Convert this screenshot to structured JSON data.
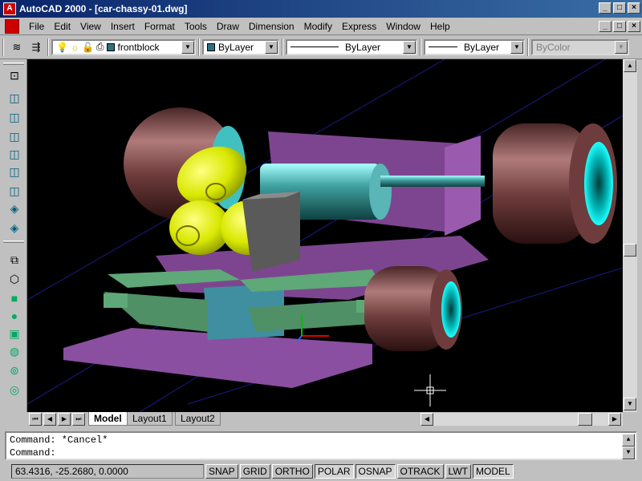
{
  "window": {
    "title": "AutoCAD 2000 - [car-chassy-01.dwg]",
    "buttons": [
      "_",
      "□",
      "×"
    ]
  },
  "menubar": {
    "items": [
      "File",
      "Edit",
      "View",
      "Insert",
      "Format",
      "Tools",
      "Draw",
      "Dimension",
      "Modify",
      "Express",
      "Window",
      "Help"
    ],
    "doc_buttons": [
      "_",
      "□",
      "×"
    ]
  },
  "properties_toolbar": {
    "layer": "frontblock",
    "color": "ByLayer",
    "linetype": "ByLayer",
    "lineweight": "ByLayer",
    "plotstyle": "ByColor",
    "accent_colors": {
      "layer_swatch": "#2f6f7f",
      "color_swatch": "#2f6f7f"
    }
  },
  "left_toolbar": {
    "icons": [
      "zoom-extents-icon",
      "box-icon",
      "wedge-icon",
      "cone-icon",
      "sphere-icon",
      "cylinder-icon",
      "torus-icon",
      "solid-icon",
      "view-icon",
      "cube-icon",
      "green-box-icon",
      "green-sphere-icon",
      "green-cube-icon",
      "globe-icon",
      "orbit-icon",
      "camera-icon"
    ]
  },
  "layout_tabs": {
    "nav_buttons": [
      "⏮",
      "◀",
      "▶",
      "⏭"
    ],
    "tabs": [
      "Model",
      "Layout1",
      "Layout2"
    ],
    "active": "Model"
  },
  "command_window": {
    "lines": [
      "Command: *Cancel*",
      "Command:"
    ]
  },
  "statusbar": {
    "coordinates": "63.4316, -25.2680, 0.0000",
    "toggles": [
      {
        "label": "SNAP",
        "on": false
      },
      {
        "label": "GRID",
        "on": false
      },
      {
        "label": "ORTHO",
        "on": false
      },
      {
        "label": "POLAR",
        "on": true
      },
      {
        "label": "OSNAP",
        "on": true
      },
      {
        "label": "OTRACK",
        "on": false
      },
      {
        "label": "LWT",
        "on": false
      },
      {
        "label": "MODEL",
        "on": true
      }
    ]
  },
  "scene_colors": {
    "background": "#000000",
    "chassis": "#8a4fa0",
    "tire": "#6e3c3c",
    "rim": "#00c8c8",
    "fuel_tanks": "#e0f000",
    "wings": "#5fa878",
    "block": "#5a5a5a",
    "cylinder": "#3fa0a0"
  }
}
